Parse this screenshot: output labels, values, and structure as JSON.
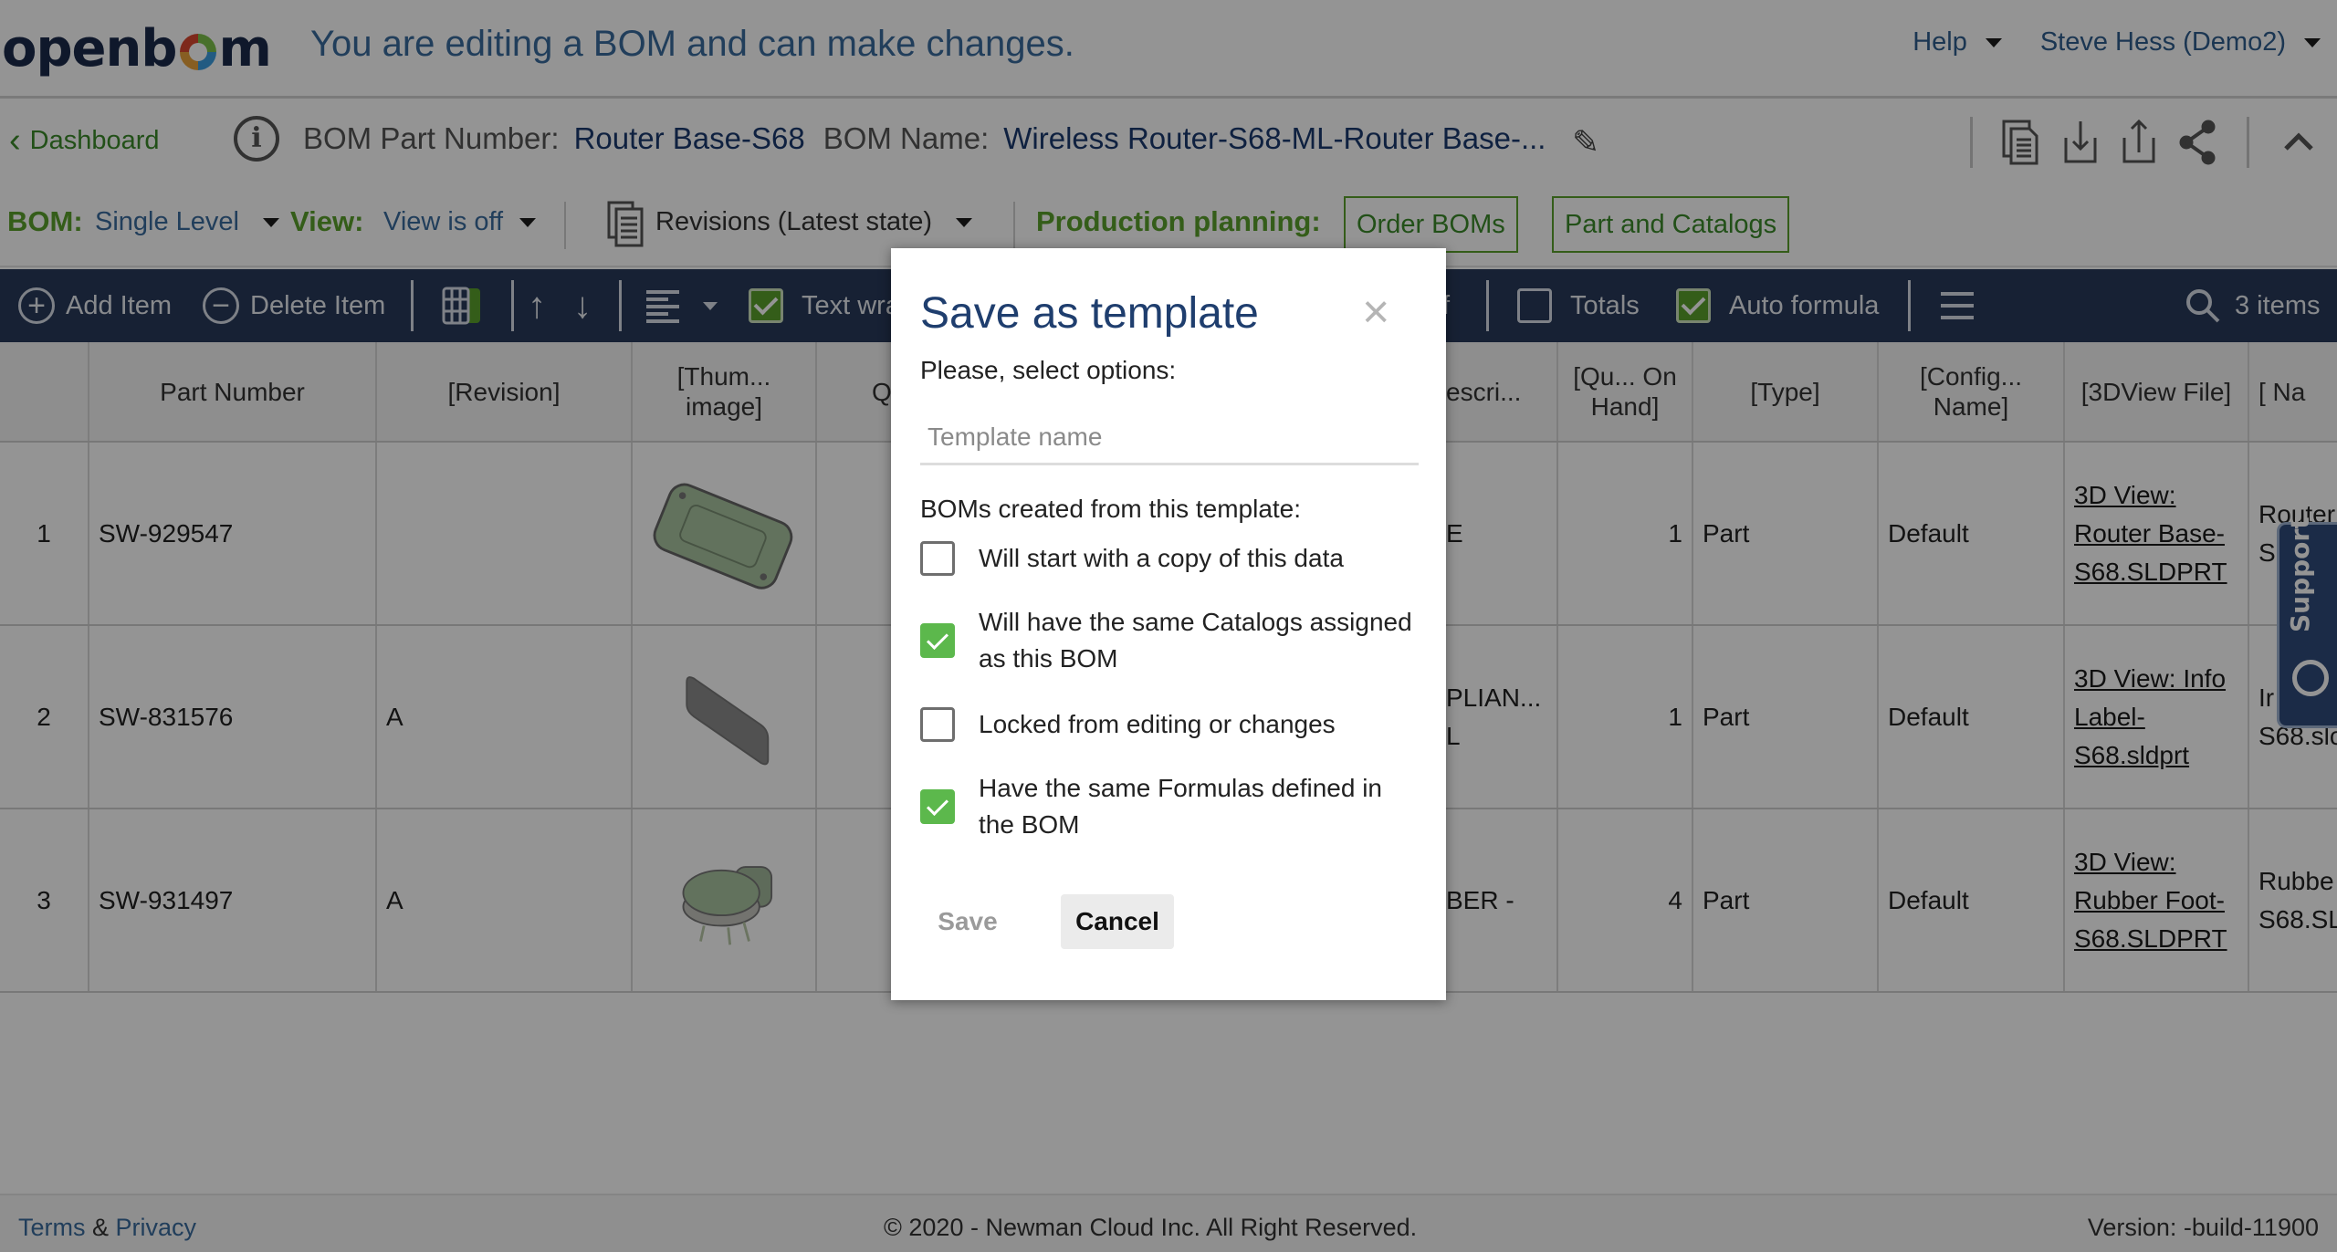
{
  "header": {
    "logo_text_left": "openb",
    "logo_text_right": "m",
    "message": "You are editing a BOM and can make changes.",
    "help_label": "Help",
    "user_label": "Steve Hess (Demo2)"
  },
  "bom_info": {
    "back_label": "Dashboard",
    "part_number_label": "BOM Part Number:",
    "part_number_value": "Router Base-S68",
    "name_label": "BOM Name:",
    "name_value": "Wireless Router-S68-ML-Router Base-...",
    "icons": [
      "copy-document-icon",
      "download-icon",
      "upload-icon",
      "share-icon",
      "collapse-chevron-up-icon"
    ]
  },
  "options_bar": {
    "bom_label": "BOM:",
    "bom_value": "Single Level",
    "view_label": "View:",
    "view_value": "View is off",
    "revisions_label": "Revisions (Latest state)",
    "production_label": "Production planning:",
    "order_boms_label": "Order BOMs",
    "part_catalogs_label": "Part and Catalogs"
  },
  "toolbar": {
    "add_item": "Add Item",
    "delete_item": "Delete Item",
    "text_wrap": "Text wrap",
    "text_wrap_checked": true,
    "hidden_fragment": "f",
    "totals": "Totals",
    "totals_checked": false,
    "auto_formula": "Auto formula",
    "auto_formula_checked": true,
    "item_count": "3 items"
  },
  "table": {
    "columns": [
      "",
      "Part Number",
      "[Revision]",
      "[Thum... image]",
      "Q",
      "escri...",
      "[Qu... On Hand]",
      "[Type]",
      "[Config... Name]",
      "[3DView File]",
      "[ Na"
    ],
    "rows": [
      {
        "index": "1",
        "part_number": "SW-929547",
        "revision": "",
        "thumbnail": "router-base-thumbnail",
        "description": "E",
        "qty_on_hand": "1",
        "type": "Part",
        "config_name": "Default",
        "view_file": "3D View: Router Base-S68.SLDPRT",
        "name": "Router S"
      },
      {
        "index": "2",
        "part_number": "SW-831576",
        "revision": "A",
        "thumbnail": "info-label-thumbnail",
        "description": "PLIAN... L",
        "qty_on_hand": "1",
        "type": "Part",
        "config_name": "Default",
        "view_file": "3D View: Info Label-S68.sldprt",
        "name": "Ir S68.slc"
      },
      {
        "index": "3",
        "part_number": "SW-931497",
        "revision": "A",
        "thumbnail": "rubber-foot-thumbnail",
        "description": "BER -",
        "qty_on_hand": "4",
        "type": "Part",
        "config_name": "Default",
        "view_file": "3D View: Rubber Foot-S68.SLDPRT",
        "name": "Rubbe S68.SL"
      }
    ]
  },
  "support_tab": {
    "label": "Support"
  },
  "footer": {
    "terms": "Terms",
    "amp": "&",
    "privacy": "Privacy",
    "copyright": "© 2020 - Newman Cloud Inc. All Right Reserved.",
    "version": "Version: -build-11900"
  },
  "modal": {
    "title": "Save as template",
    "subtitle": "Please, select options:",
    "template_name_placeholder": "Template name",
    "template_name_value": "",
    "options_heading": "BOMs created from this template:",
    "options": [
      {
        "label": "Will start with a copy of this data",
        "checked": false
      },
      {
        "label": "Will have the same Catalogs assigned as this BOM",
        "checked": true
      },
      {
        "label": "Locked from editing or changes",
        "checked": false
      },
      {
        "label": "Have the same Formulas defined in the BOM",
        "checked": true
      }
    ],
    "save_label": "Save",
    "cancel_label": "Cancel"
  },
  "colors": {
    "brand_green": "#5aa02c",
    "link_blue": "#3a6b9e",
    "toolbar_navy": "#283a5b",
    "title_navy": "#1f3e6e",
    "check_green": "#5cb84c"
  }
}
